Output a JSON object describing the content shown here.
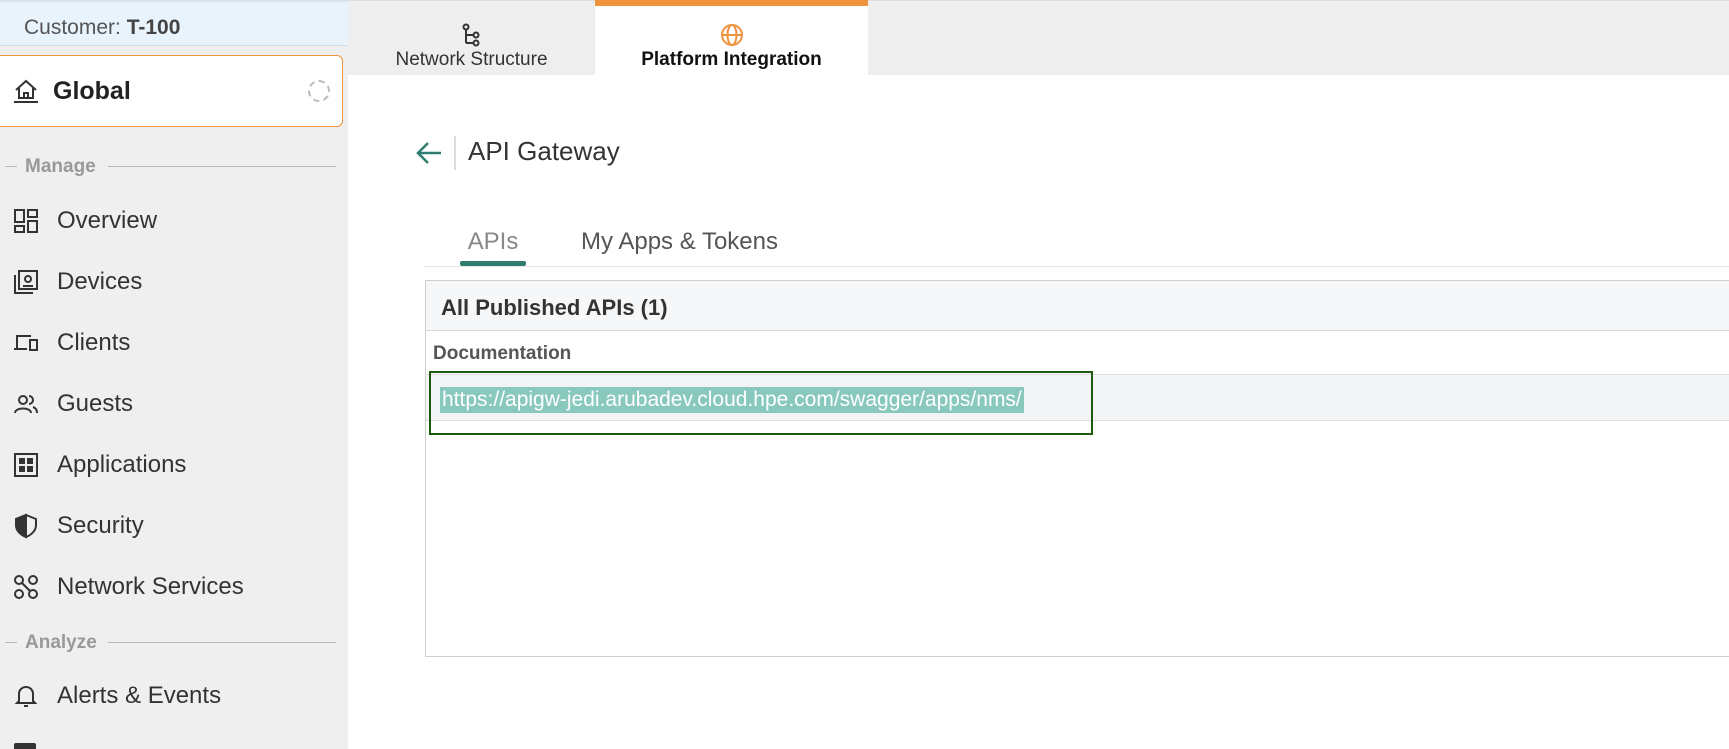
{
  "sidebar": {
    "customer_label": "Customer:",
    "customer_value": "T-100",
    "scope": "Global",
    "sections": {
      "manage": "Manage",
      "analyze": "Analyze"
    },
    "items": [
      {
        "label": "Overview",
        "icon": "grid-icon"
      },
      {
        "label": "Devices",
        "icon": "devices-icon"
      },
      {
        "label": "Clients",
        "icon": "clients-icon"
      },
      {
        "label": "Guests",
        "icon": "guests-icon"
      },
      {
        "label": "Applications",
        "icon": "applications-icon"
      },
      {
        "label": "Security",
        "icon": "shield-icon"
      },
      {
        "label": "Network Services",
        "icon": "network-services-icon"
      },
      {
        "label": "Alerts & Events",
        "icon": "bell-icon"
      }
    ]
  },
  "topnav": {
    "tabs": [
      {
        "label": "Network Structure",
        "icon": "hierarchy-icon"
      },
      {
        "label": "Platform Integration",
        "icon": "globe-icon",
        "active": true
      }
    ]
  },
  "main": {
    "title": "API Gateway",
    "tabs": [
      {
        "label": "APIs",
        "active": true
      },
      {
        "label": "My Apps & Tokens"
      }
    ],
    "panel": {
      "title": "All Published APIs (1)",
      "column": "Documentation",
      "rows": [
        {
          "url": "https://apigw-jedi.arubadev.cloud.hpe.com/swagger/apps/nms/"
        }
      ]
    }
  },
  "colors": {
    "accent_orange": "#f0933f",
    "accent_teal": "#2e7d6e",
    "highlight_green": "#1e5a0e",
    "selection": "#88c8bd"
  }
}
